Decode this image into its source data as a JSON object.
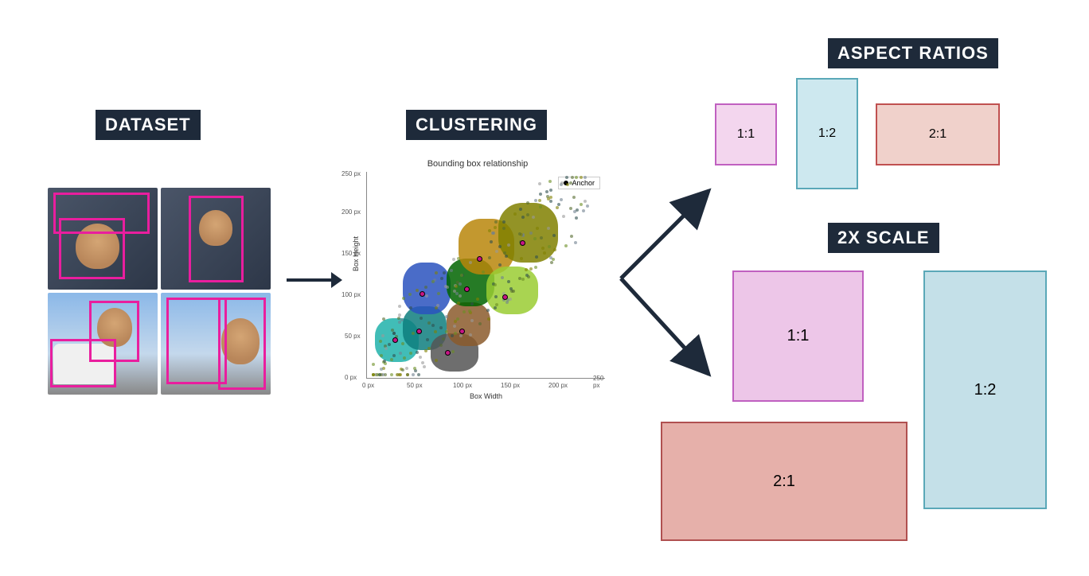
{
  "headings": {
    "dataset": "DATASET",
    "clustering": "CLUSTERING",
    "aspect": "ASPECT RATIOS",
    "scale": "2X SCALE"
  },
  "aspect_ratio_boxes": {
    "one_one": "1:1",
    "one_two": "1:2",
    "two_one": "2:1"
  },
  "scale_boxes": {
    "one_one": "1:1",
    "one_two": "1:2",
    "two_one": "2:1"
  },
  "chart_data": {
    "type": "scatter",
    "title": "Bounding box relationship",
    "xlabel": "Box Width",
    "ylabel": "Box Height",
    "xlim": [
      0,
      250
    ],
    "ylim": [
      0,
      250
    ],
    "x_ticks": [
      "0 px",
      "50 px",
      "100 px",
      "150 px",
      "200 px",
      "250 px"
    ],
    "y_ticks": [
      "0 px",
      "50 px",
      "100 px",
      "150 px",
      "200 px",
      "250 px"
    ],
    "legend": [
      "Anchor"
    ],
    "cluster_anchors": [
      {
        "x": 30,
        "y": 45,
        "color": "#20b2aa"
      },
      {
        "x": 55,
        "y": 55,
        "color": "#008b8b"
      },
      {
        "x": 60,
        "y": 100,
        "color": "#2a52be"
      },
      {
        "x": 85,
        "y": 30,
        "color": "#555555"
      },
      {
        "x": 100,
        "y": 55,
        "color": "#8b5a2b"
      },
      {
        "x": 105,
        "y": 105,
        "color": "#006400"
      },
      {
        "x": 120,
        "y": 140,
        "color": "#b8860b"
      },
      {
        "x": 145,
        "y": 95,
        "color": "#9acd32"
      },
      {
        "x": 165,
        "y": 160,
        "color": "#808000"
      }
    ],
    "note": "Dense scatter of ~thousands of (width,height) bounding-box points, colored by k-means cluster (k≈9), with black anchor markers at cluster centers."
  },
  "diagram_flow": [
    "DATASET (images with magenta bounding boxes)",
    "→",
    "CLUSTERING (scatter of box width vs height, colored clusters with anchors)",
    "↗ ASPECT RATIOS (example boxes 1:1, 1:2, 2:1)",
    "↘ 2X SCALE (same ratios at 2× size)"
  ]
}
